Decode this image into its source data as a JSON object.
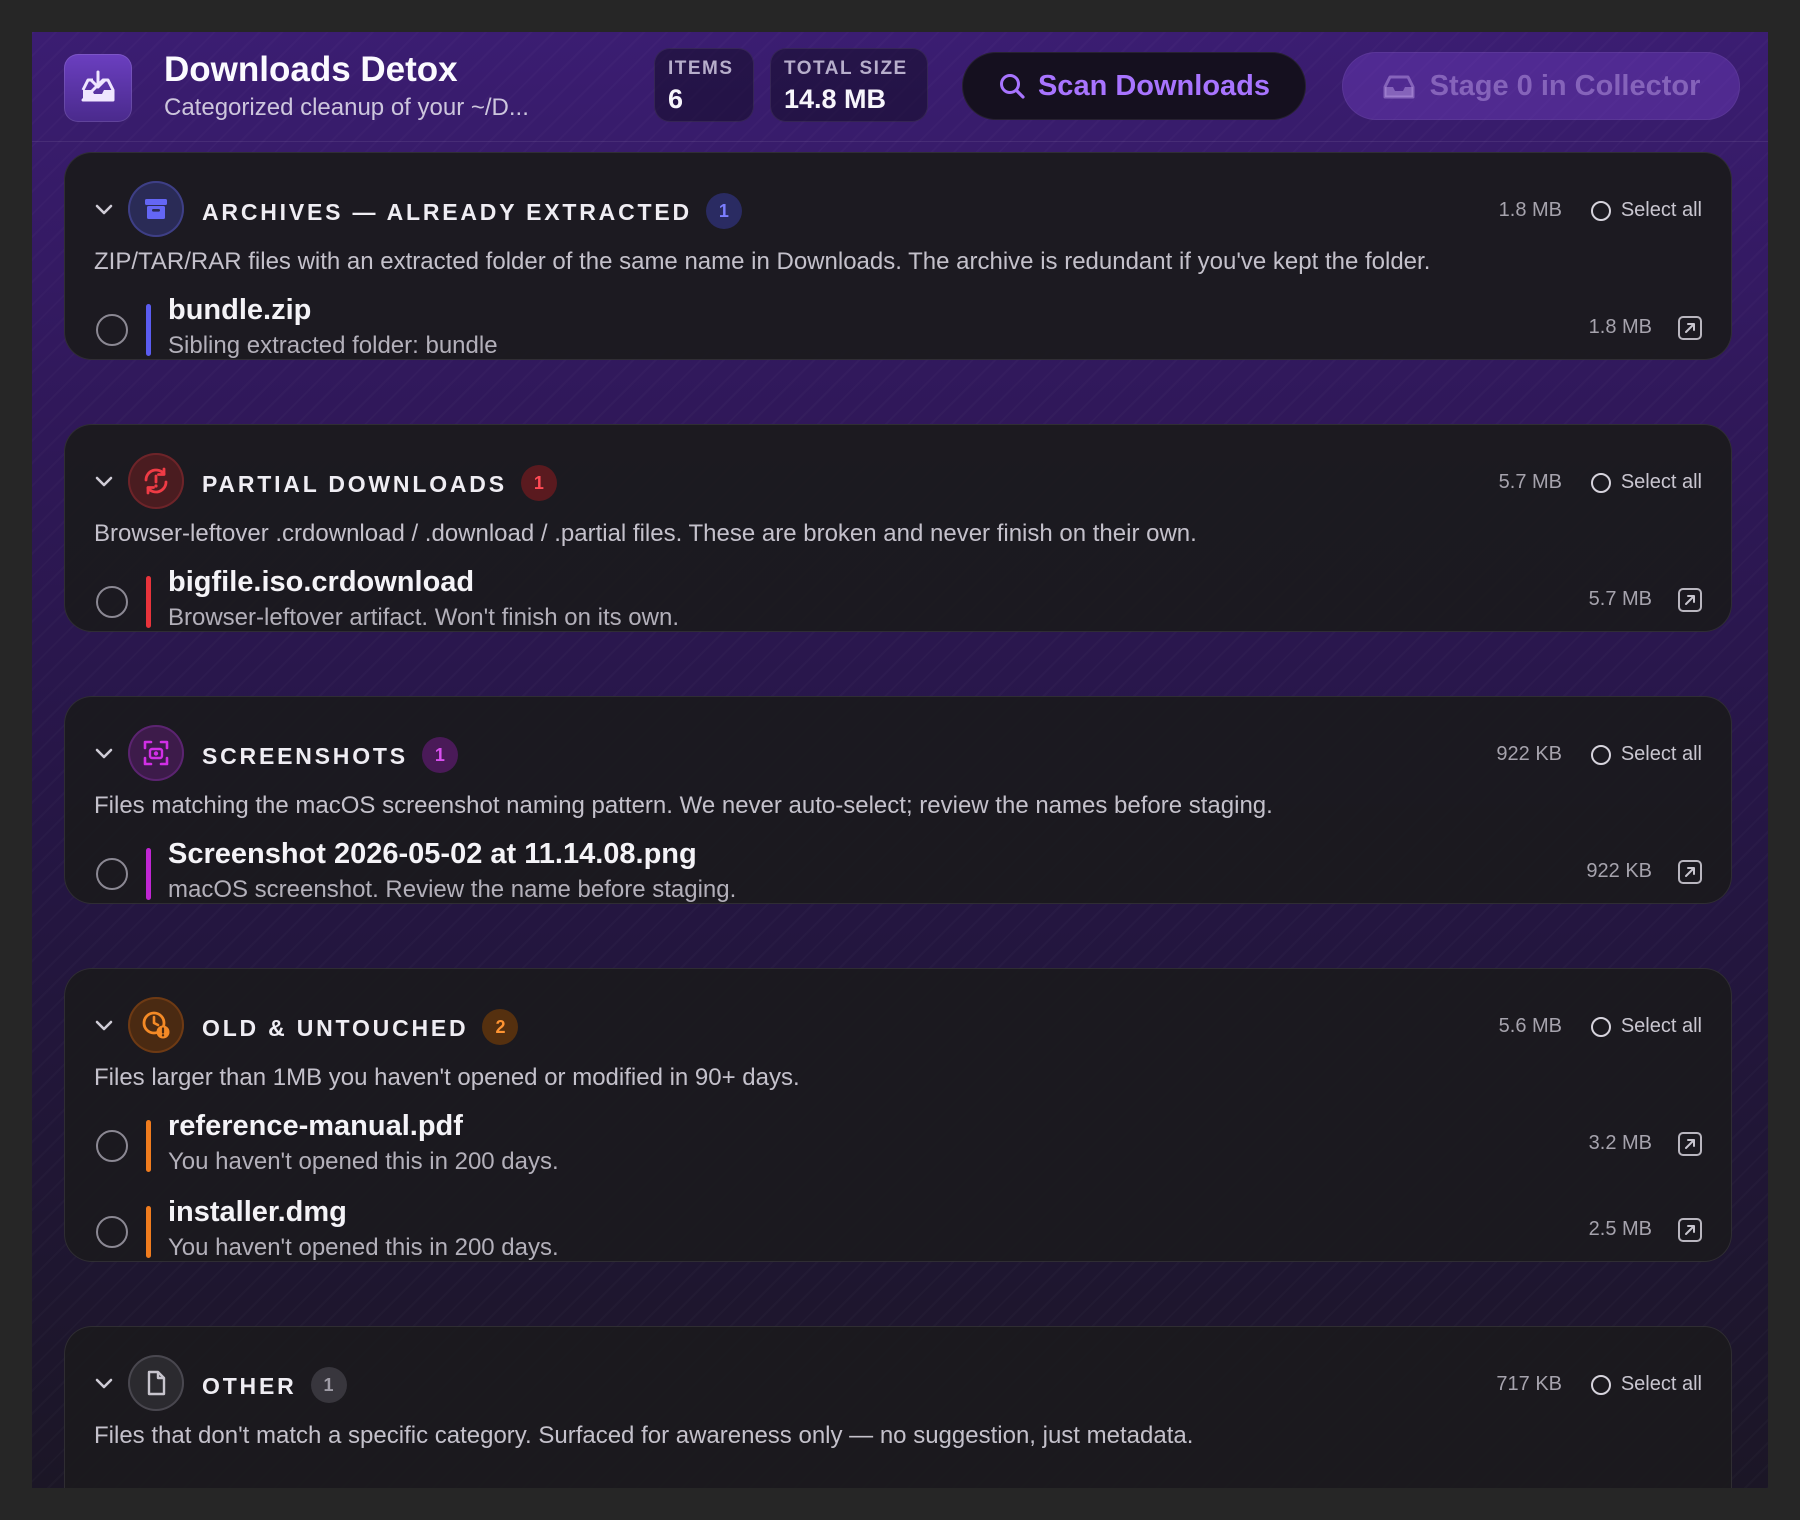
{
  "header": {
    "title": "Downloads Detox",
    "subtitle": "Categorized cleanup of your ~/D...",
    "stats": [
      {
        "label": "ITEMS",
        "value": "6"
      },
      {
        "label": "TOTAL SIZE",
        "value": "14.8 MB"
      }
    ],
    "scan_label": "Scan Downloads",
    "stage_label": "Stage 0 in Collector"
  },
  "sections": [
    {
      "title": "ARCHIVES — ALREADY EXTRACTED",
      "count": "1",
      "size": "1.8 MB",
      "select_all": "Select all",
      "description": "ZIP/TAR/RAR files with an extracted folder of the same name in Downloads. The archive is redundant if you've kept the folder.",
      "icon": "archive-box-icon",
      "color": "#5b5cf0",
      "items": [
        {
          "name": "bundle.zip",
          "sub": "Sibling extracted folder: bundle",
          "size": "1.8 MB"
        }
      ]
    },
    {
      "title": "PARTIAL DOWNLOADS",
      "count": "1",
      "size": "5.7 MB",
      "select_all": "Select all",
      "description": "Browser-leftover .crdownload / .download / .partial files. These are broken and never finish on their own.",
      "icon": "refresh-warning-icon",
      "color": "#e8333b",
      "items": [
        {
          "name": "bigfile.iso.crdownload",
          "sub": "Browser-leftover artifact. Won't finish on its own.",
          "size": "5.7 MB"
        }
      ]
    },
    {
      "title": "SCREENSHOTS",
      "count": "1",
      "size": "922 KB",
      "select_all": "Select all",
      "description": "Files matching the macOS screenshot naming pattern. We never auto-select; review the names before staging.",
      "icon": "screenshot-icon",
      "color": "#c026d3",
      "items": [
        {
          "name": "Screenshot 2026-05-02 at 11.14.08.png",
          "sub": "macOS screenshot. Review the name before staging.",
          "size": "922 KB"
        }
      ]
    },
    {
      "title": "OLD & UNTOUCHED",
      "count": "2",
      "size": "5.6 MB",
      "select_all": "Select all",
      "description": "Files larger than 1MB you haven't opened or modified in 90+ days.",
      "icon": "clock-alert-icon",
      "color": "#f07c1e",
      "items": [
        {
          "name": "reference-manual.pdf",
          "sub": "You haven't opened this in 200 days.",
          "size": "3.2 MB"
        },
        {
          "name": "installer.dmg",
          "sub": "You haven't opened this in 200 days.",
          "size": "2.5 MB"
        }
      ]
    },
    {
      "title": "OTHER",
      "count": "1",
      "size": "717 KB",
      "select_all": "Select all",
      "description": "Files that don't match a specific category. Surfaced for awareness only — no suggestion, just metadata.",
      "icon": "document-icon",
      "color": "#8e8b94",
      "items": []
    }
  ]
}
